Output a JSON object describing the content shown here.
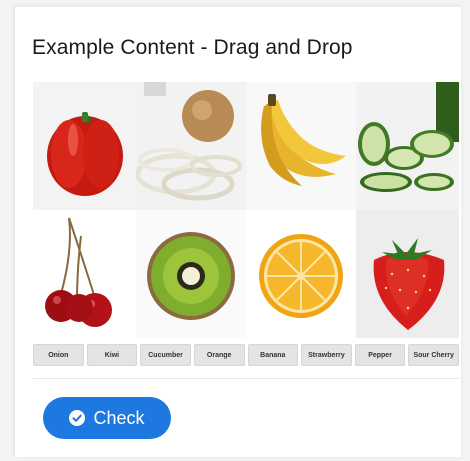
{
  "page": {
    "title": "Example Content - Drag and Drop"
  },
  "images": [
    {
      "icon": "bell-pepper-image"
    },
    {
      "icon": "onion-image"
    },
    {
      "icon": "banana-image"
    },
    {
      "icon": "cucumber-image"
    },
    {
      "icon": "cherry-image"
    },
    {
      "icon": "kiwi-image"
    },
    {
      "icon": "orange-image"
    },
    {
      "icon": "strawberry-image"
    }
  ],
  "labels": [
    "Onion",
    "Kiwi",
    "Cucumber",
    "Orange",
    "Banana",
    "Strawberry",
    "Pepper",
    "Sour Cherry"
  ],
  "check_button": {
    "label": "Check",
    "icon": "check-circle-icon"
  },
  "colors": {
    "accent": "#1d79e0",
    "chip_bg": "#e4e4e4"
  }
}
